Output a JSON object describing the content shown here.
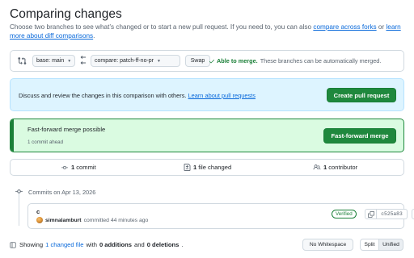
{
  "header": {
    "title": "Comparing changes",
    "subtitle_prefix": "Choose two branches to see what’s changed or to start a new pull request. If you need to, you can also",
    "compare_forks_link": "compare across forks",
    "subtitle_or": "or",
    "diff_link": "learn more about diff comparisons",
    "subtitle_end": "."
  },
  "range": {
    "base_label": "base: main",
    "compare_label": "compare: patch-ff-no-pr",
    "swap_label": "Swap",
    "merge_status": "Able to merge.",
    "merge_status_detail": "These branches can be automatically merged."
  },
  "pr_banner": {
    "message": "Discuss and review the changes in this comparison with others.",
    "link": "Learn about pull requests",
    "button": "Create pull request"
  },
  "fast_forward": {
    "title": "Fast-forward merge possible",
    "subtitle": "1 commit ahead",
    "button": "Fast-forward merge"
  },
  "stats": {
    "commits_count": "1",
    "commits_label": "commit",
    "files_count": "1",
    "files_label": "file changed",
    "contributors_count": "1",
    "contributors_label": "contributor"
  },
  "timeline": {
    "date_label": "Commits on Apr 13, 2026"
  },
  "commit": {
    "message": "c",
    "author": "simnalamburt",
    "committed_text": "committed 44 minutes ago",
    "verified": "Verified",
    "sha": "c525a83"
  },
  "footer": {
    "showing_prefix": "Showing",
    "changed_files": "1 changed file",
    "with_text": "with",
    "additions_count": "0 additions",
    "and_text": "and",
    "deletions_count": "0 deletions",
    "end": ".",
    "whitespace_button": "No Whitespace",
    "split_button": "Split",
    "unified_button": "Unified"
  },
  "colors": {
    "accent_blue": "#0969da",
    "success_green": "#1f883d",
    "banner_blue_bg": "#ddf4ff",
    "banner_green_bg": "#dafbe1"
  },
  "icons": {
    "range": "git-compare-icon",
    "arrow": "arrow-left-icon",
    "check": "check-icon",
    "commit": "git-commit-icon",
    "file": "file-diff-icon",
    "people": "people-icon",
    "timeline": "git-commit-icon",
    "copy": "copy-icon",
    "browse": "code-icon",
    "file_tree": "file-tree-toggle-icon"
  }
}
